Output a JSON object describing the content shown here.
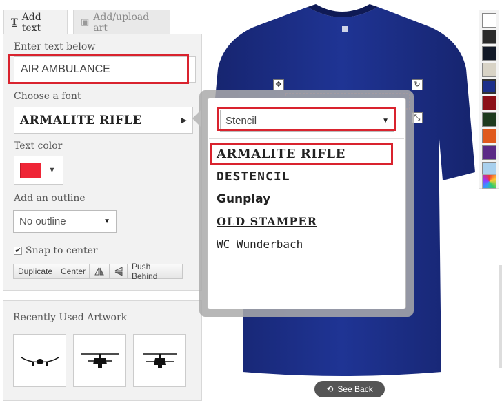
{
  "tabs": [
    {
      "label": "Add text",
      "icon": "text-icon",
      "active": true
    },
    {
      "label": "Add/upload art",
      "icon": "image-icon",
      "active": false
    }
  ],
  "text_panel": {
    "enter_label": "Enter text below",
    "text_value": "AIR AMBULANCE",
    "font_label": "Choose a font",
    "font_value": "ARMALITE RIFLE",
    "color_label": "Text color",
    "color_value": "#ef2536",
    "outline_label": "Add an outline",
    "outline_value": "No outline",
    "snap_label": "Snap to center",
    "snap_checked": true,
    "buttons": [
      "Duplicate",
      "Center",
      "Push Behind"
    ]
  },
  "recent": {
    "title": "Recently Used Artwork",
    "items": [
      "airplane-icon",
      "helicopter-icon",
      "helicopter-icon"
    ]
  },
  "font_popup": {
    "category": "Stencil",
    "fonts": [
      "ARMALITE RIFLE",
      "DESTENCIL",
      "Gunplay",
      "OLD STAMPER",
      "WC Wunderbach"
    ],
    "selected": "ARMALITE RIFLE"
  },
  "shirt": {
    "color": "#1c2f8a",
    "see_back": "See Back"
  },
  "palette": {
    "colors": [
      "#ffffff",
      "#2a2a2a",
      "#111827",
      "#d8d3c6",
      "#1c2f8a",
      "#8c0f17",
      "#1e3a1e",
      "#e0591c",
      "#5b2a86",
      "#a9d0ee",
      "multicolor-icon"
    ]
  }
}
